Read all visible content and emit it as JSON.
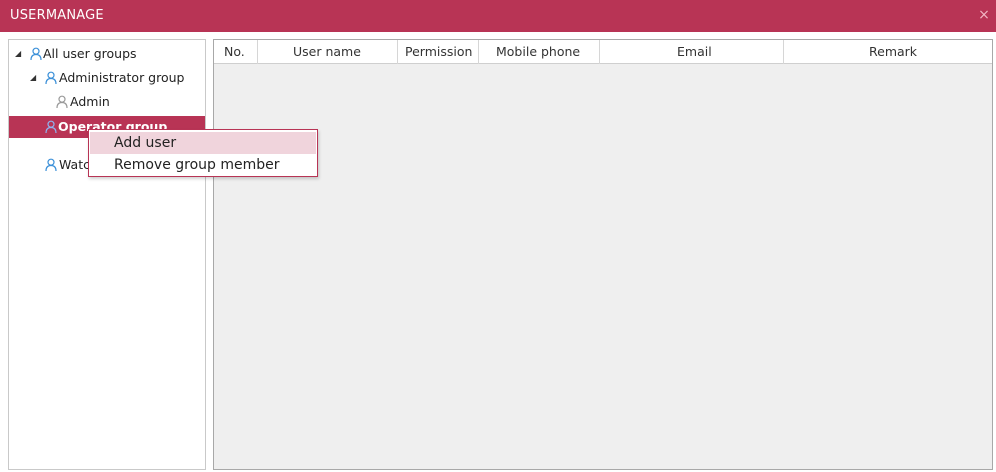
{
  "window": {
    "title": "USERMANAGE",
    "close_glyph": "×"
  },
  "colors": {
    "accent": "#b83455",
    "menu_hover": "#f0d4dc",
    "user_icon": "#3a8fd8",
    "user_icon_gray": "#999999"
  },
  "tree": {
    "expand_glyph": "◢",
    "nodes": [
      {
        "label": "All user groups",
        "expanded": true,
        "icon": "user-icon"
      },
      {
        "label": "Administrator group",
        "expanded": true,
        "icon": "user-icon"
      },
      {
        "label": "Admin",
        "icon": "user-icon"
      },
      {
        "label": "Operator group",
        "selected": true,
        "icon": "user-icon"
      },
      {
        "label": "Watc",
        "icon": "user-icon"
      }
    ]
  },
  "grid": {
    "columns": [
      "No.",
      "User name",
      "Permission",
      "Mobile phone",
      "Email",
      "Remark"
    ],
    "rows": []
  },
  "context_menu": {
    "items": [
      {
        "label": "Add user",
        "highlighted": true
      },
      {
        "label": "Remove group member"
      }
    ]
  }
}
